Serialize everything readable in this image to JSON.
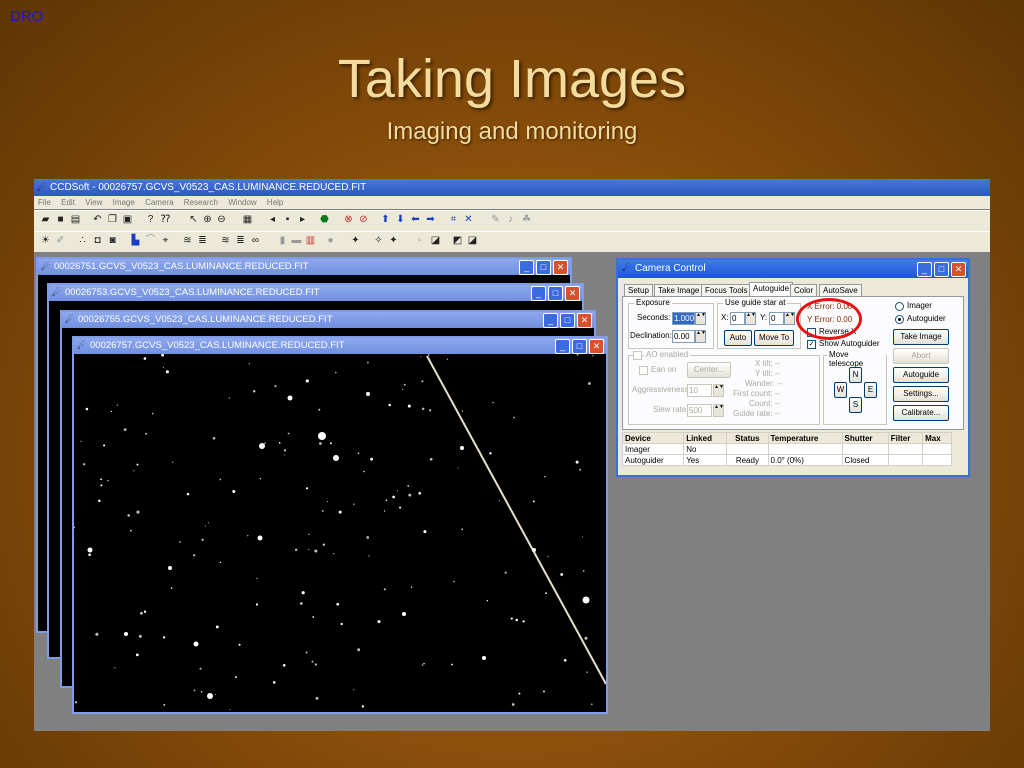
{
  "slide": {
    "corner_label": "DRO",
    "title": "Taking Images",
    "subtitle": "Imaging and monitoring"
  },
  "colors": {
    "background": "#8a4f0a",
    "title_text": "#f3dc9e",
    "xp_title_blue": "#2a58c0",
    "highlight_ring": "#e81010"
  },
  "app": {
    "title": "CCDSoft - 00026757.GCVS_V0523_CAS.LUMINANCE.REDUCED.FIT",
    "menu": [
      "File",
      "Edit",
      "View",
      "Image",
      "Camera",
      "Research",
      "Window",
      "Help"
    ]
  },
  "image_windows": [
    {
      "title": "00026751.GCVS_V0523_CAS.LUMINANCE.REDUCED.FIT"
    },
    {
      "title": "00026753.GCVS_V0523_CAS.LUMINANCE.REDUCED.FIT"
    },
    {
      "title": "00026755.GCVS_V0523_CAS.LUMINANCE.REDUCED.FIT"
    },
    {
      "title": "00026757.GCVS_V0523_CAS.LUMINANCE.REDUCED.FIT"
    }
  ],
  "camera_control": {
    "title": "Camera Control",
    "tabs": [
      "Setup",
      "Take Image",
      "Focus Tools",
      "Autoguide",
      "Color",
      "AutoSave"
    ],
    "exposure": {
      "label": "Exposure",
      "seconds_label": "Seconds:",
      "seconds_value": "1.000",
      "declination_label": "Declination:",
      "declination_value": "0.00"
    },
    "guide_star": {
      "label": "Use guide star at",
      "x_label": "X:",
      "x_value": "0",
      "y_label": "Y:",
      "y_value": "0",
      "auto_button": "Auto",
      "move_to_button": "Move To"
    },
    "errors": {
      "x_error": "X Error: 0.00",
      "y_error": "Y Error: 0.00"
    },
    "reverse_x": "Reverse X",
    "show_autoguider": "Show Autoguider",
    "device_choice": {
      "imager": "Imager",
      "autoguider": "Autoguider"
    },
    "buttons": {
      "take_image": "Take Image",
      "abort": "Abort",
      "autoguide": "Autoguide",
      "settings": "Settings...",
      "calibrate": "Calibrate..."
    },
    "ao": {
      "enabled_label": "AO enabled",
      "ean_on": "Ean on",
      "center_button": "Center...",
      "aggressiveness_label": "Aggressiveness:",
      "aggressiveness_value": "10",
      "slew_rate_label": "Slew rate:",
      "slew_rate_value": "500"
    },
    "ao_stats": [
      "X tilt: --",
      "Y tilt: --",
      "Wander: --",
      "First count: --",
      "Count: --",
      "Guide rate: --"
    ],
    "move_telescope": {
      "label": "Move telescope",
      "n": "N",
      "s": "S",
      "e": "E",
      "w": "W"
    },
    "device_table": {
      "columns": [
        "Device",
        "Linked",
        "Status",
        "Temperature",
        "Shutter",
        "Filter",
        "Max"
      ],
      "rows": [
        [
          "Imager",
          "No",
          "",
          "",
          "",
          "",
          ""
        ],
        [
          "Autoguider",
          "Yes",
          "Ready",
          "0.0° (0%)",
          "Closed",
          "",
          ""
        ]
      ]
    }
  }
}
